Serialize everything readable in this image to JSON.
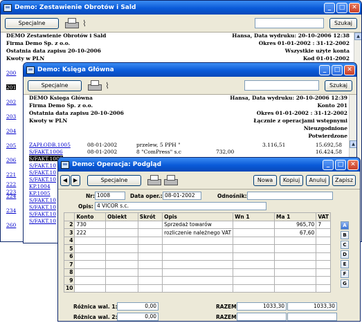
{
  "win1": {
    "title": "Demo: Zestawienie Obrotów i Sald",
    "special_label": "Specjalne",
    "search_label": "Szukaj",
    "header_left": [
      "DEMO Zestawienie Obrotów i Sald",
      "Firma Demo Sp. z o.o.",
      "Ostatnia data zapisu 20-10-2006",
      "Kwoty w PLN"
    ],
    "header_right": [
      "Hansa, Data wydruku: 20-10-2006 12:38",
      "Okres 01-01-2002 : 31-12-2002",
      "Wszystkie użyte konta",
      "Kod 01-01-2002"
    ],
    "links": [
      "200",
      "201",
      "202",
      "203",
      "204",
      "205",
      "206",
      "221",
      "222",
      "223",
      "224",
      "234",
      "260"
    ]
  },
  "win2": {
    "title": "Demo: Księga Główna",
    "special_label": "Specjalne",
    "search_label": "Szukaj",
    "header_left": [
      "DEMO Księga Główna",
      "Firma Demo Sp. z o.o.",
      "Ostatnia data zapisu 20-10-2006",
      "Kwoty w PLN"
    ],
    "header_right": [
      "Hansa, Data wydruku: 20-10-2006 12:39",
      "Konto 201",
      "Okres 01-01-2002 : 31-12-2002",
      "Łącznie z operacjami wstępnymi",
      "Nieuzgodnione",
      "Potwierdzone"
    ],
    "rows": [
      {
        "ref": "ZAPŁODB.1005",
        "date": "08-01-2002",
        "desc": "przelew, 5 PPH \"",
        "debit": "",
        "credit": "3.116,51",
        "balance": "15.692,58"
      },
      {
        "ref": "S/FAKT.1006",
        "date": "08-01-2002",
        "desc": "8 \"ComPress\" s.c",
        "debit": "732,00",
        "credit": "",
        "balance": "16.424,58"
      },
      {
        "ref": "S/FAKT.1007",
        "date": "",
        "desc": "",
        "debit": "",
        "credit": "",
        "balance": ""
      },
      {
        "ref": "S/FAKT.10",
        "date": "",
        "desc": "",
        "debit": "",
        "credit": "",
        "balance": ""
      },
      {
        "ref": "S/FAKT.10",
        "date": "",
        "desc": "",
        "debit": "",
        "credit": "",
        "balance": ""
      },
      {
        "ref": "S/FAKT.10",
        "date": "",
        "desc": "",
        "debit": "",
        "credit": "",
        "balance": ""
      },
      {
        "ref": "KP.1004",
        "date": "",
        "desc": "",
        "debit": "",
        "credit": "",
        "balance": ""
      },
      {
        "ref": "KP.1005",
        "date": "",
        "desc": "",
        "debit": "",
        "credit": "",
        "balance": ""
      },
      {
        "ref": "S/FAKT.10",
        "date": "",
        "desc": "",
        "debit": "",
        "credit": "",
        "balance": ""
      },
      {
        "ref": "S/FAKT.10",
        "date": "",
        "desc": "",
        "debit": "",
        "credit": "",
        "balance": ""
      },
      {
        "ref": "S/FAKT.10",
        "date": "",
        "desc": "",
        "debit": "",
        "credit": "",
        "balance": ""
      },
      {
        "ref": "S/FAKT.10",
        "date": "",
        "desc": "",
        "debit": "",
        "credit": "",
        "balance": ""
      }
    ]
  },
  "win3": {
    "title": "Demo: Operacja: Podgląd",
    "special_label": "Specjalne",
    "btn_new": "Nowa",
    "btn_copy": "Kopiuj",
    "btn_cancel": "Anuluj",
    "btn_save": "Zapisz",
    "nr_label": "Nr:",
    "nr_value": "1008",
    "date_label": "Data oper.:",
    "date_value": "08-01-2002",
    "ref_label": "Odnośnik:",
    "ref_value": "",
    "desc_label": "Opis:",
    "desc_value": "4 VICOR s.c.",
    "columns": [
      "",
      "Konto",
      "Obiekt",
      "Skrót",
      "Opis",
      "Wn 1",
      "Ma 1",
      "VAT"
    ],
    "rows": [
      {
        "n": "2",
        "konto": "730",
        "obiekt": "",
        "skrot": "",
        "opis": "Sprzedaż towarów",
        "wn": "",
        "ma": "965,70",
        "vat": "7"
      },
      {
        "n": "3",
        "konto": "222",
        "obiekt": "",
        "skrot": "",
        "opis": "rozliczenie należnego VAT",
        "wn": "",
        "ma": "67,60",
        "vat": ""
      },
      {
        "n": "4"
      },
      {
        "n": "5"
      },
      {
        "n": "6"
      },
      {
        "n": "7"
      },
      {
        "n": "8"
      },
      {
        "n": "9"
      },
      {
        "n": "10"
      }
    ],
    "letters": [
      "A",
      "B",
      "C",
      "D",
      "E",
      "F",
      "G"
    ],
    "diff1_label": "Różnica wal. 1:",
    "diff1_value": "0,00",
    "diff2_label": "Różnica wal. 2:",
    "diff2_value": "0,00",
    "razem_label": "RAZEM:",
    "razem_wn": "1033,30",
    "razem_ma": "1033,30",
    "razem2_label": "RAZEM:"
  }
}
